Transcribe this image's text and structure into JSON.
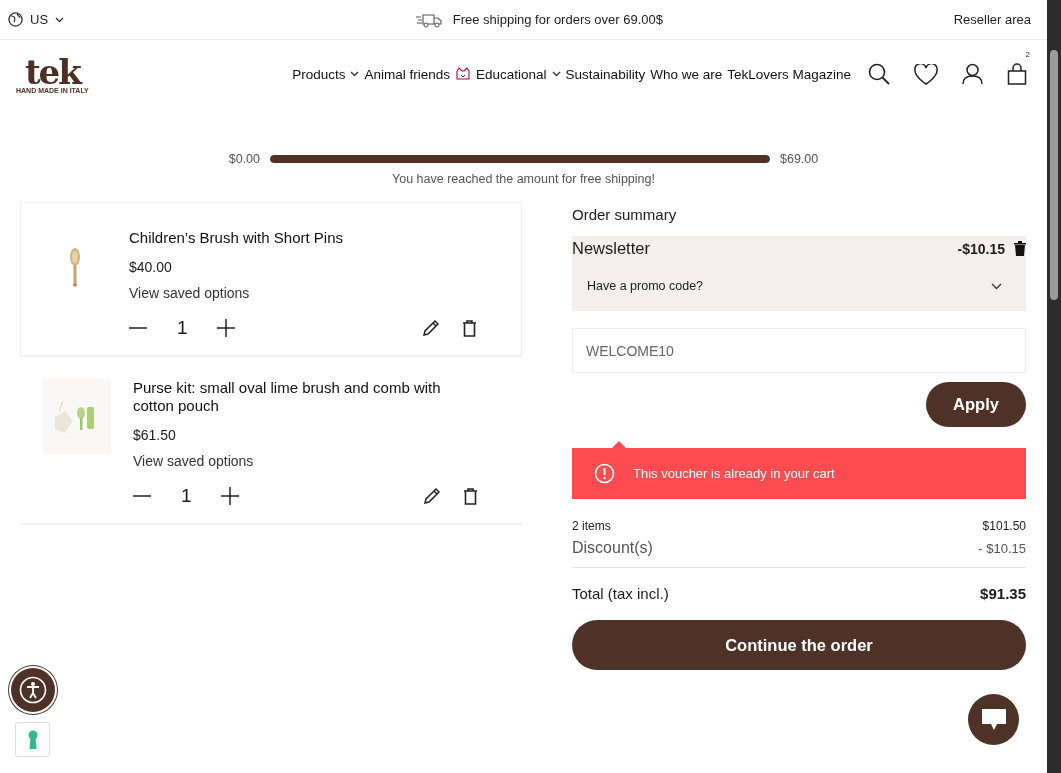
{
  "top_bar": {
    "region": "US",
    "shipping_notice": "Free shipping for orders over 69.00$",
    "reseller_link": "Reseller area"
  },
  "header": {
    "logo": {
      "name": "tek",
      "tagline": "HAND MADE IN ITALY"
    },
    "nav": [
      {
        "label": "Products",
        "has_dropdown": true,
        "kind": "text"
      },
      {
        "label": "Animal friends",
        "has_dropdown": false,
        "kind": "text"
      },
      {
        "label": "Educational",
        "has_dropdown": true,
        "kind": "icon"
      },
      {
        "label": "Sustainability",
        "has_dropdown": false,
        "kind": "text"
      },
      {
        "label": "Who we are",
        "has_dropdown": false,
        "kind": "text"
      },
      {
        "label": "TekLovers Magazine",
        "has_dropdown": false,
        "kind": "text"
      }
    ],
    "cart_count": "2"
  },
  "free_shipping": {
    "min": "$0.00",
    "max": "$69.00",
    "level": 1.0,
    "message": "You have reached the amount for free shipping!"
  },
  "cart_items": [
    {
      "name": "Children’s Brush with Short Pins",
      "price": "$40.00",
      "options_link": "View saved options",
      "quantity": "1",
      "kind": "brush"
    },
    {
      "name": "Purse kit: small oval lime brush and comb with cotton pouch",
      "price": "$61.50",
      "options_link": "View saved options",
      "quantity": "1",
      "kind": "kit"
    }
  ],
  "order_summary": {
    "title": "Order summary",
    "voucher": {
      "name": "Newsletter",
      "amount": "-$10.15"
    },
    "promo_toggle": {
      "label": "Have a promo code?",
      "expanded": false
    },
    "promo_input": {
      "value": "WELCOME10"
    },
    "apply_button": "Apply",
    "error": "This voucher is already in your cart",
    "items_label": "2 items",
    "items_total": "$101.50",
    "discount_label": "Discount(s)",
    "discount_value": "- $10.15",
    "total_label": "Total (tax incl.)",
    "total_value": "$91.35",
    "continue_button": "Continue the order"
  }
}
